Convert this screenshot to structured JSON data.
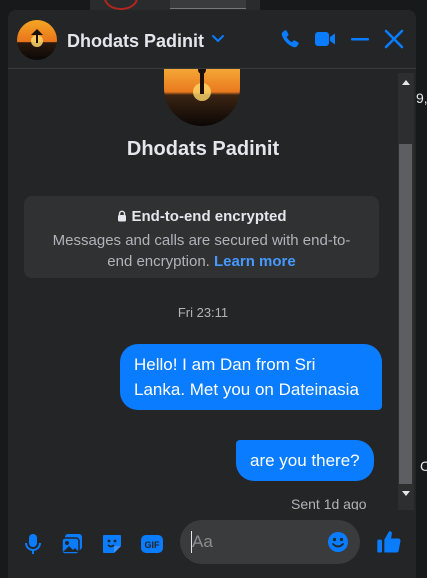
{
  "background": {
    "fragment_top": "9,",
    "fragment_bottom": "C"
  },
  "header": {
    "contact_name": "Dhodats Padinit",
    "icons": [
      "chevron-down-icon",
      "phone-icon",
      "video-icon",
      "minimize-icon",
      "close-icon"
    ]
  },
  "profile": {
    "name": "Dhodats Padinit"
  },
  "encryption_notice": {
    "title": "End-to-end encrypted",
    "text": "Messages and calls are secured with end-to-end encryption.",
    "link": "Learn more"
  },
  "conversation": {
    "timestamp": "Fri 23:11",
    "messages": [
      {
        "text": "Hello! I am Dan from Sri Lanka. Met you on Dateinasia",
        "sender": "me"
      },
      {
        "text": "are you there?",
        "sender": "me"
      }
    ],
    "status": "Sent 1d ago"
  },
  "composer": {
    "placeholder": "Aa",
    "icons": [
      "microphone-icon",
      "photo-icon",
      "sticker-icon",
      "gif-icon",
      "emoji-icon",
      "thumbs-up-icon"
    ]
  },
  "colors": {
    "accent": "#0a7cff",
    "window_bg": "#242526",
    "link": "#4599ff"
  }
}
